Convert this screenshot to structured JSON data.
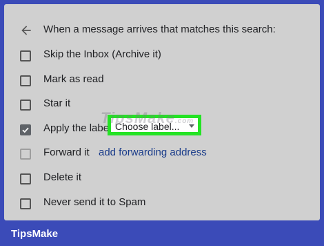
{
  "header": {
    "text": "When a message arrives that matches this search:"
  },
  "options": [
    {
      "label": "Skip the Inbox (Archive it)",
      "checked": false
    },
    {
      "label": "Mark as read",
      "checked": false
    },
    {
      "label": "Star it",
      "checked": false
    },
    {
      "label": "Apply the label:",
      "checked": true,
      "select_value": "Choose label..."
    },
    {
      "label": "Forward it",
      "checked": false,
      "disabled": true,
      "link": "add forwarding address"
    },
    {
      "label": "Delete it",
      "checked": false
    },
    {
      "label": "Never send it to Spam",
      "checked": false
    }
  ],
  "branding": {
    "name": "TipsMake",
    "watermark": "TipsMake",
    "watermark_suffix": ".com"
  },
  "colors": {
    "frame": "#3b4bb8",
    "panel": "#d0d0d0",
    "highlight": "#24e324",
    "link": "#1a3c8a"
  },
  "icons": {
    "back": "arrow-left-icon",
    "check": "checkmark-icon",
    "dropdown": "caret-down-icon"
  }
}
